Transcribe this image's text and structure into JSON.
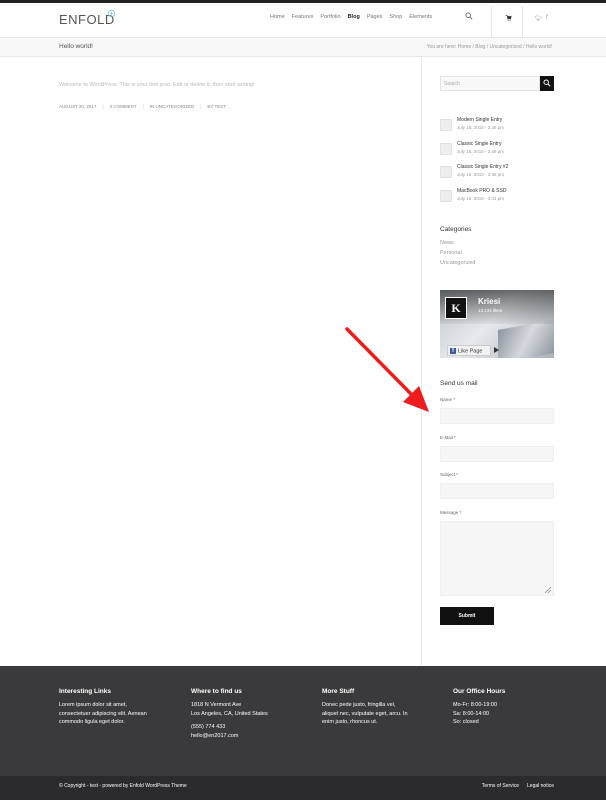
{
  "header": {
    "logo": "ENFOLD",
    "nav": [
      "Home",
      "Features",
      "Portfolio",
      "Blog",
      "Pages",
      "Shop",
      "Elements"
    ],
    "active_nav": "Blog"
  },
  "titlebar": {
    "title": "Hello world!",
    "breadcrumb": "You are here: Home / Blog / Uncategorized / Hello world!"
  },
  "post": {
    "excerpt": "Welcome to WordPress. This is your first post. Edit or delete it, then start writing!",
    "date": "AUGUST 20, 2017",
    "comments": "0 COMMENT",
    "category": "IN UNCATEGORIZED",
    "author": "BY TEST"
  },
  "sidebar": {
    "search_placeholder": "Search",
    "entries": [
      {
        "title": "Modern Single Entry",
        "date": "July 15, 2015 - 3:48 pm"
      },
      {
        "title": "Classic Single Entry",
        "date": "July 15, 2015 - 3:48 pm"
      },
      {
        "title": "Classic Single Entry #2",
        "date": "July 15, 2015 - 3:46 pm"
      },
      {
        "title": "MacBook PRO & SSD",
        "date": "July 15, 2015 - 3:41 pm"
      }
    ],
    "categories_title": "Categories",
    "categories": [
      "News",
      "Personal",
      "Uncategorized"
    ],
    "facebook": {
      "logo_letter": "K",
      "name": "Kriesi",
      "likes": "13,131 likes",
      "like_label": "Like Page"
    },
    "form": {
      "title": "Send us mail",
      "name_label": "Name",
      "email_label": "E-Mail",
      "subject_label": "Subject",
      "message_label": "Message",
      "required_mark": "*",
      "submit_label": "Submit"
    }
  },
  "footer": {
    "columns": [
      {
        "title": "Interesting Links",
        "lines": [
          "Lorem ipsum dolor sit amet,",
          "consectetuer adipiscing elit. Aenean",
          "commodo ligula eget dolor."
        ],
        "lines2": []
      },
      {
        "title": "Where to find us",
        "lines": [
          "1818 N Vermont Ave",
          "Los Angeles, CA, United States"
        ],
        "lines2": [
          "(555) 774 433",
          "hello@en2017.com"
        ]
      },
      {
        "title": "More Stuff",
        "lines": [
          "Donec pede justo, fringilla vel,",
          "aliquet nec, vulputate eget, arcu. In",
          "enim justo, rhoncus ut."
        ],
        "lines2": []
      },
      {
        "title": "Our Office Hours",
        "lines": [
          "Mo-Fr: 8:00-19:00",
          "Sa: 8:00-14:00",
          "So: closed"
        ],
        "lines2": []
      }
    ],
    "copyright": "© Copyright - test - powered by Enfold WordPress Theme",
    "links": [
      "Terms of Service",
      "Legal notice"
    ]
  },
  "colors": {
    "annotation_arrow": "#ee1c1c",
    "footer_bg": "#3a3a3c",
    "socket_bg": "#2b2b2d",
    "logo_accent": "#7cc4e8"
  }
}
